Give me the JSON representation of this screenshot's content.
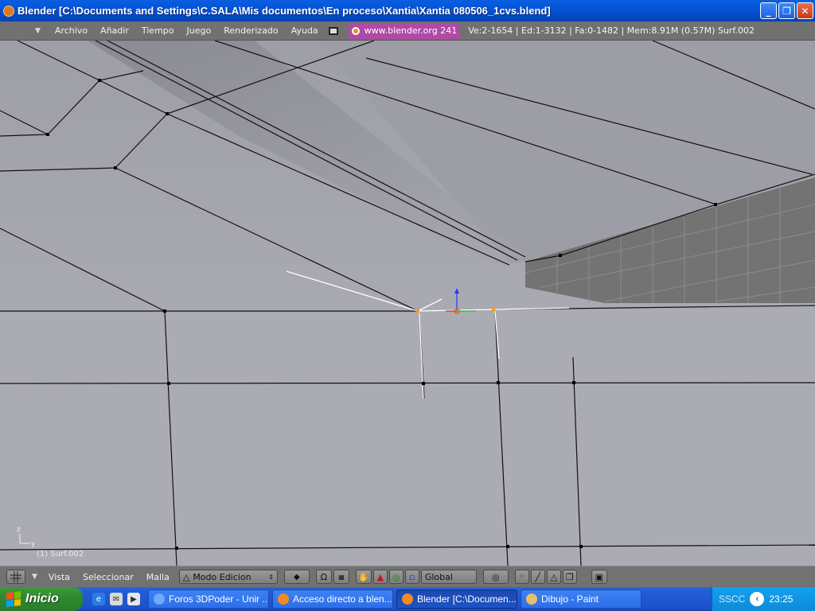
{
  "window": {
    "title": "Blender [C:\\Documents and Settings\\C.SALA\\Mis documentos\\En proceso\\Xantia\\Xantia 080506_1cvs.blend]",
    "buttons": {
      "minimize": "_",
      "maximize": "❐",
      "close": "✕"
    }
  },
  "menubar": {
    "items": [
      "Archivo",
      "Añadir",
      "Tiempo",
      "Juego",
      "Renderizado",
      "Ayuda"
    ],
    "url": "www.blender.org 241",
    "stats": "Ve:2-1654 | Ed:1-3132 | Fa:0-1482 | Mem:8.91M (0.57M) Surf.002"
  },
  "viewport": {
    "object_label": "(1) Surf.002",
    "axis_z": "z",
    "axis_y": "y"
  },
  "header3d": {
    "menus": [
      "Vista",
      "Seleccionar",
      "Malla"
    ],
    "mode": "Modo Edicion",
    "orientation": "Global"
  },
  "taskbar": {
    "start_label": "Inicio",
    "tasks": [
      {
        "label": "Foros 3DPoder - Unir ..."
      },
      {
        "label": "Acceso directo a blen..."
      },
      {
        "label": "Blender [C:\\Documen..."
      },
      {
        "label": "Dibujo - Paint"
      }
    ],
    "tray_text": "SSCC",
    "clock": "23:25"
  },
  "colors": {
    "titlebar": "#0454d6",
    "menubar": "#717171",
    "viewport": "#a7a7af",
    "url_box": "#b04aa6",
    "taskbar": "#245edb",
    "start": "#2f8a2f"
  }
}
